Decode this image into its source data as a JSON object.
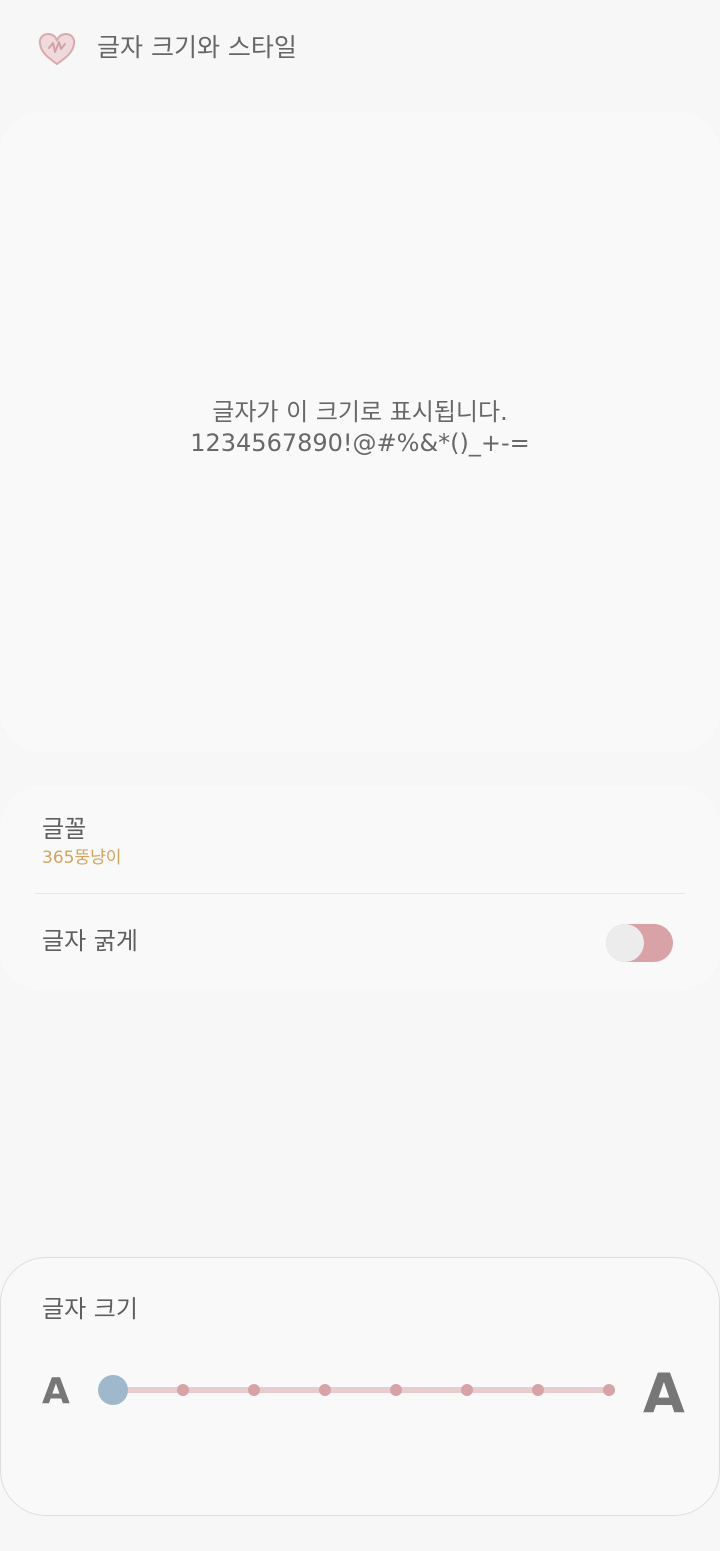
{
  "header": {
    "title": "글자 크기와 스타일",
    "back_icon": "heart-icon"
  },
  "preview": {
    "line1": "글자가 이 크기로 표시됩니다.",
    "line2": "1234567890!@#%&*()_+-="
  },
  "settings": {
    "font": {
      "label": "글꼴",
      "value": "365뚱냥이"
    },
    "bold": {
      "label": "글자 굵게",
      "enabled": false
    }
  },
  "text_size": {
    "title": "글자 크기",
    "small_label": "A",
    "large_label": "A",
    "level_count": 8,
    "selected_level": 1
  },
  "colors": {
    "accent": "#D9A2A6",
    "thumb": "#9FB8CB",
    "font_value": "#D4A35F"
  }
}
